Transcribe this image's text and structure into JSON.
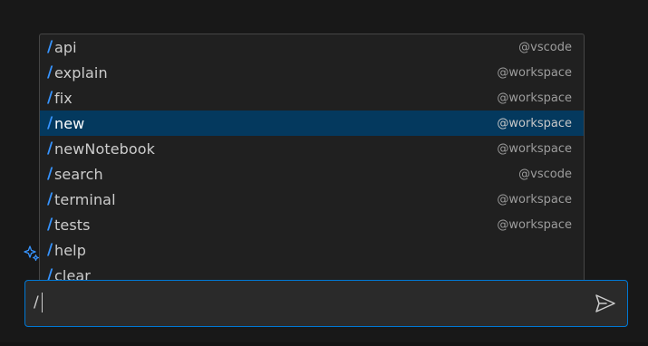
{
  "suggestions": [
    {
      "command": "api",
      "agent": "@vscode",
      "selected": false
    },
    {
      "command": "explain",
      "agent": "@workspace",
      "selected": false
    },
    {
      "command": "fix",
      "agent": "@workspace",
      "selected": false
    },
    {
      "command": "new",
      "agent": "@workspace",
      "selected": true
    },
    {
      "command": "newNotebook",
      "agent": "@workspace",
      "selected": false
    },
    {
      "command": "search",
      "agent": "@vscode",
      "selected": false
    },
    {
      "command": "terminal",
      "agent": "@workspace",
      "selected": false
    },
    {
      "command": "tests",
      "agent": "@workspace",
      "selected": false
    },
    {
      "command": "help",
      "agent": "",
      "selected": false
    },
    {
      "command": "clear",
      "agent": "",
      "selected": false
    }
  ],
  "slash": "/",
  "input": {
    "value": "/"
  },
  "colors": {
    "accent": "#3794ff",
    "selection": "#04395e",
    "focus_border": "#0078d4"
  },
  "icons": {
    "sparkle": "sparkle-icon",
    "send": "send-icon"
  }
}
